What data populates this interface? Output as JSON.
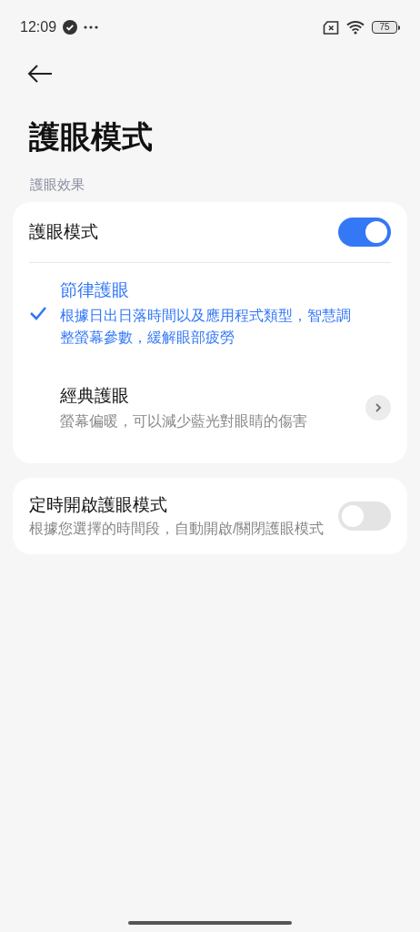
{
  "status_bar": {
    "time": "12:09",
    "battery": "75"
  },
  "title": "護眼模式",
  "section_label": "護眼效果",
  "main_toggle": {
    "label": "護眼模式",
    "on": true
  },
  "modes": [
    {
      "title": "節律護眼",
      "description": "根據日出日落時間以及應用程式類型，智慧調整螢幕參數，緩解眼部疲勞",
      "selected": true,
      "chevron": false
    },
    {
      "title": "經典護眼",
      "description": "螢幕偏暖，可以減少藍光對眼睛的傷害",
      "selected": false,
      "chevron": true
    }
  ],
  "schedule": {
    "title": "定時開啟護眼模式",
    "description": "根據您選擇的時間段，自動開啟/關閉護眼模式",
    "on": false
  }
}
